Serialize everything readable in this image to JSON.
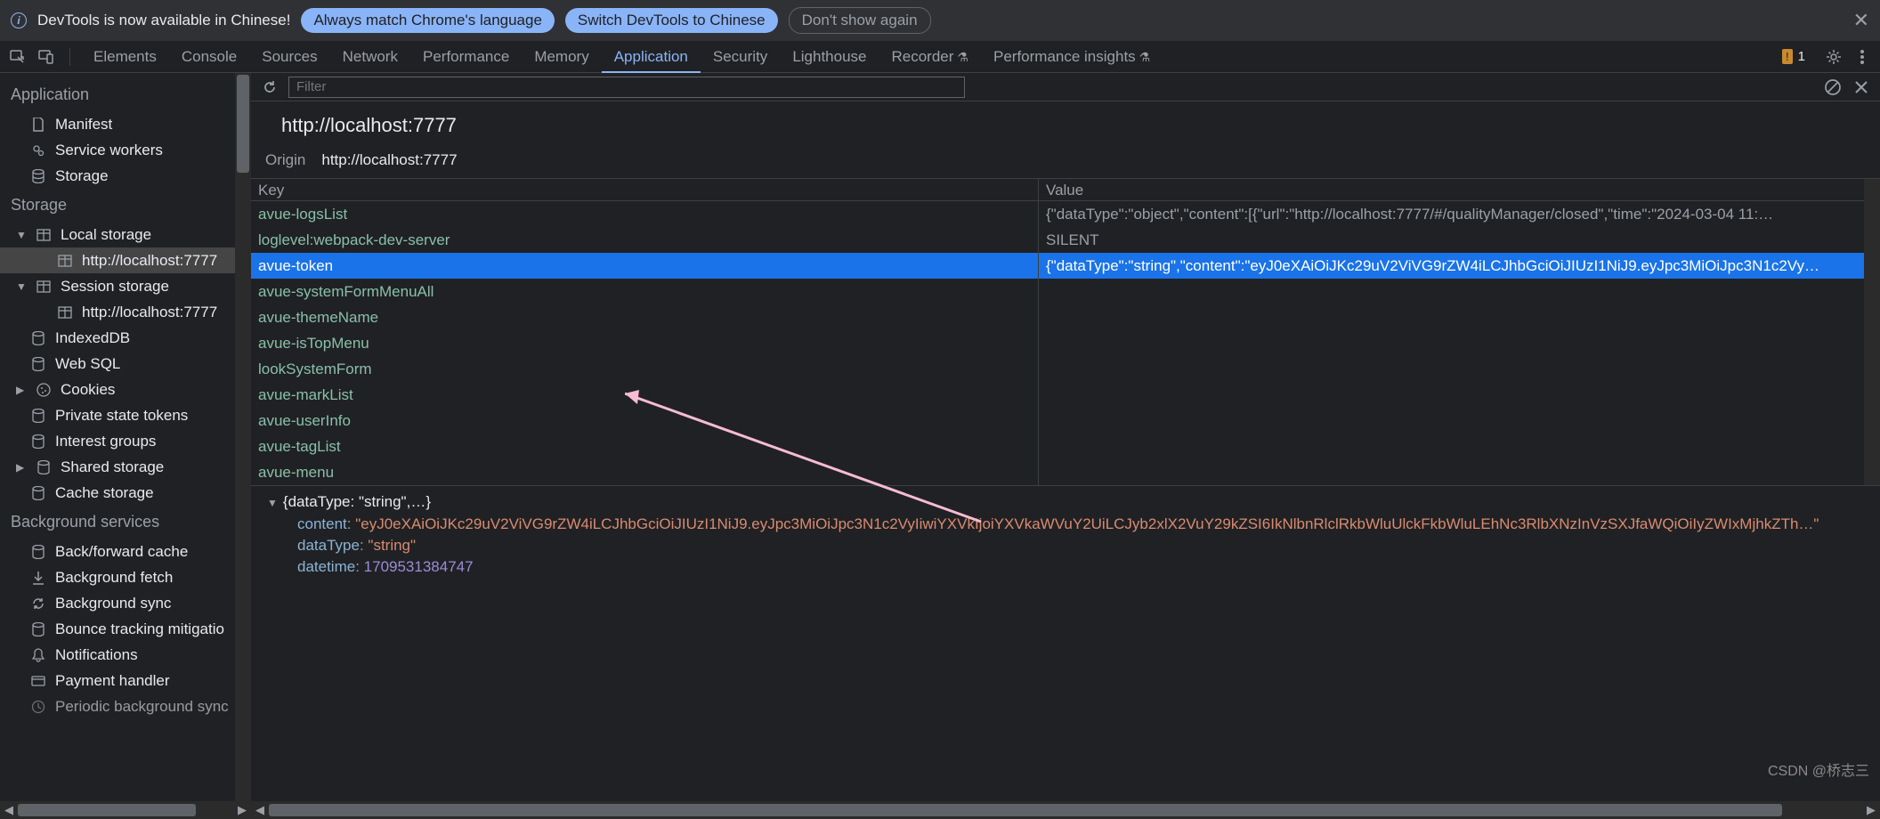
{
  "banner": {
    "text": "DevTools is now available in Chinese!",
    "match_btn": "Always match Chrome's language",
    "switch_btn": "Switch DevTools to Chinese",
    "dont_btn": "Don't show again"
  },
  "tabs": {
    "items": [
      "Elements",
      "Console",
      "Sources",
      "Network",
      "Performance",
      "Memory",
      "Application",
      "Security",
      "Lighthouse",
      "Recorder",
      "Performance insights"
    ],
    "active": "Application",
    "warn_count": "1"
  },
  "toolbar": {
    "filter_placeholder": "Filter"
  },
  "header": {
    "title": "http://localhost:7777"
  },
  "origin": {
    "label": "Origin",
    "value": "http://localhost:7777"
  },
  "sidebar": {
    "cat_app": "Application",
    "app_items": {
      "manifest": "Manifest",
      "sw": "Service workers",
      "storage": "Storage"
    },
    "cat_storage": "Storage",
    "local_storage": "Local storage",
    "local_storage_child": "http://localhost:7777",
    "session_storage": "Session storage",
    "session_storage_child": "http://localhost:7777",
    "indexeddb": "IndexedDB",
    "websql": "Web SQL",
    "cookies": "Cookies",
    "priv_tokens": "Private state tokens",
    "interest": "Interest groups",
    "shared": "Shared storage",
    "cache": "Cache storage",
    "cat_bg": "Background services",
    "bfcache": "Back/forward cache",
    "bgfetch": "Background fetch",
    "bgsync": "Background sync",
    "bounce": "Bounce tracking mitigatio",
    "notif": "Notifications",
    "payment": "Payment handler",
    "periodic": "Periodic background sync"
  },
  "table": {
    "key_head": "Key",
    "val_head": "Value",
    "rows": [
      {
        "k": "avue-logsList",
        "v": "{\"dataType\":\"object\",\"content\":[{\"url\":\"http://localhost:7777/#/qualityManager/closed\",\"time\":\"2024-03-04 11:…",
        "sel": false
      },
      {
        "k": "loglevel:webpack-dev-server",
        "v": "SILENT",
        "sel": false
      },
      {
        "k": "avue-token",
        "v": "{\"dataType\":\"string\",\"content\":\"eyJ0eXAiOiJKc29uV2ViVG9rZW4iLCJhbGciOiJIUzI1NiJ9.eyJpc3MiOiJpc3N1c2Vy…",
        "sel": true
      },
      {
        "k": "avue-systemFormMenuAll",
        "v": "",
        "sel": false
      },
      {
        "k": "avue-themeName",
        "v": "",
        "sel": false
      },
      {
        "k": "avue-isTopMenu",
        "v": "",
        "sel": false
      },
      {
        "k": "lookSystemForm",
        "v": "",
        "sel": false
      },
      {
        "k": "avue-markList",
        "v": "",
        "sel": false
      },
      {
        "k": "avue-userInfo",
        "v": "",
        "sel": false
      },
      {
        "k": "avue-tagList",
        "v": "",
        "sel": false
      },
      {
        "k": "avue-menu",
        "v": "",
        "sel": false
      }
    ]
  },
  "detail": {
    "head": "{dataType: \"string\",…}",
    "content_key": "content",
    "content_val": "\"eyJ0eXAiOiJKc29uV2ViVG9rZW4iLCJhbGciOiJIUzI1NiJ9.eyJpc3MiOiJpc3N1c2VyIiwiYXVkIjoiYXVkaWVuY2UiLCJyb2xlX2VuY29kZSI6IkNlbnRlclRkbWluUlckFkbWluLEhNc3RlbXNzInVzSXJfaWQiOiIyZWIxMjhkZTh…\"",
    "dtype_key": "dataType",
    "dtype_val": "\"string\"",
    "dtime_key": "datetime",
    "dtime_val": "1709531384747"
  },
  "watermark": "CSDN @桥志三"
}
